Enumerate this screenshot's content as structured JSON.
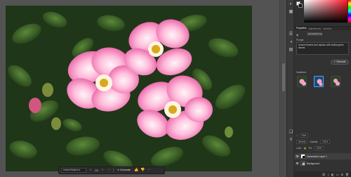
{
  "taskbar": {
    "prompt_value": "remove flowers a",
    "prev_icon": "chevron-left-icon",
    "count": "1/3",
    "next_icon": "chevron-right-icon",
    "more_icon": "more-horizontal-icon",
    "generate_label": "Generate",
    "thumbs_up_icon": "thumbs-up-icon",
    "thumbs_down_icon": "thumbs-down-icon",
    "more2_icon": "more-horizontal-icon"
  },
  "color_panel": {
    "foreground_color": "#f5f5f5",
    "background_color": "#111111",
    "field_hue": "#ff1a2e"
  },
  "tabs_top": [
    "Properties",
    "Adjustments",
    "Libraries"
  ],
  "properties": {
    "layer_chip": "Generative Layer",
    "prompt_label": "Prompt",
    "prompt_value": "remove flowers and replace with similar green leaves",
    "generate_label": "Generate",
    "variations_label": "Variations"
  },
  "tabs_bottom": [
    "Layers",
    "Channels",
    "Paths"
  ],
  "layers": {
    "kind_label": "Kind",
    "blend_mode": "Normal",
    "opacity_label": "Opacity:",
    "opacity_value": "100%",
    "lock_label": "Lock:",
    "fill_label": "Fill:",
    "fill_value": "100%",
    "rows": [
      {
        "name": "Generative Layer 1",
        "selected": true
      },
      {
        "name": "Background",
        "selected": false
      }
    ]
  }
}
